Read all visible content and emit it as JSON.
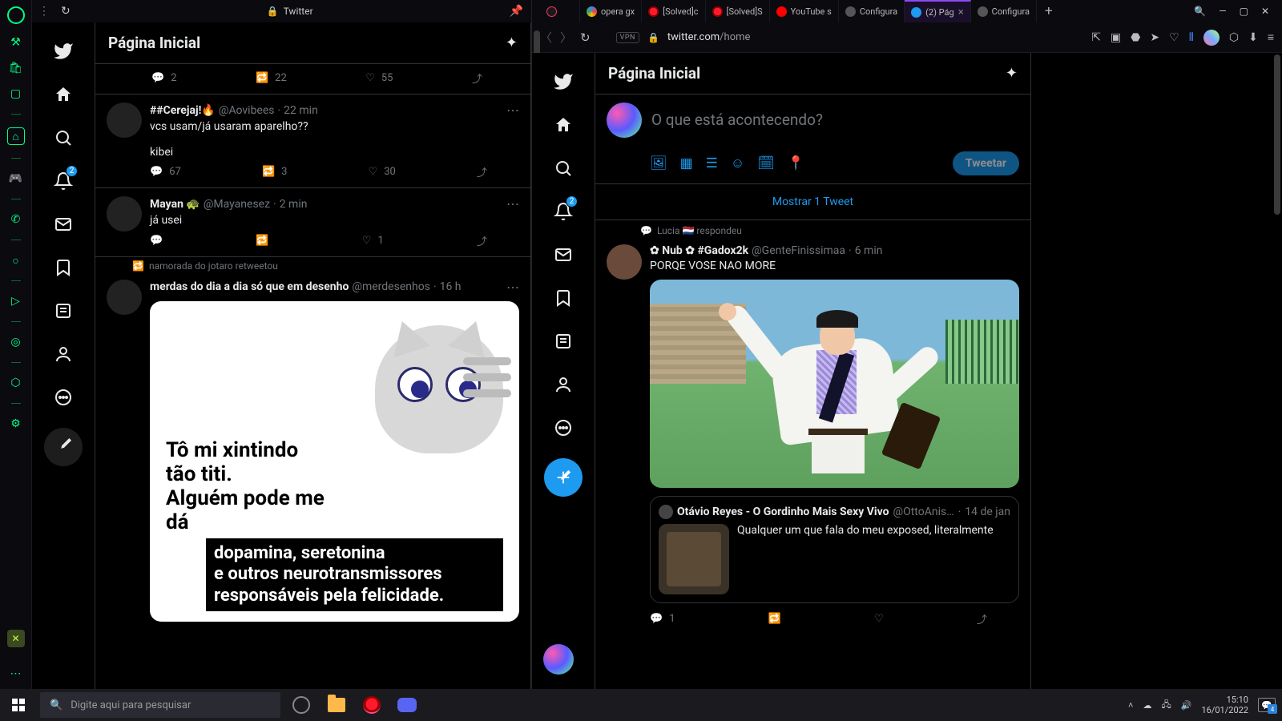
{
  "gx_rail": {
    "icons": [
      "⚙",
      "🛒",
      "📺",
      "⬚",
      "🎮",
      "—",
      "📞",
      "—",
      "○",
      "—",
      "▷",
      "—",
      "⊙",
      "—",
      "⬡",
      "—",
      "⚙"
    ]
  },
  "left_tab": {
    "title": "Twitter"
  },
  "browser_tabs": [
    {
      "fav": "gx",
      "label": ""
    },
    {
      "fav": "gg",
      "label": "opera gx"
    },
    {
      "fav": "opera",
      "label": "[Solved]c"
    },
    {
      "fav": "opera",
      "label": "[Solved]S"
    },
    {
      "fav": "yt",
      "label": "YouTube s"
    },
    {
      "fav": "cog",
      "label": "Configura"
    },
    {
      "fav": "tw",
      "label": "(2) Pág",
      "active": true,
      "close": true
    },
    {
      "fav": "cog",
      "label": "Configura"
    }
  ],
  "addr": {
    "vpn": "VPN",
    "host": "twitter.com",
    "path": "/home"
  },
  "left_feed": {
    "title": "Página Inicial",
    "notif_badge": "2",
    "top_actions": {
      "reply": "2",
      "rt": "22",
      "like": "55"
    },
    "tweets": [
      {
        "name": "##Cerejaj!🔥",
        "handle": "@Aovibees",
        "time": "22 min",
        "text": "vcs usam/já usaram aparelho??",
        "text2": "kibei",
        "reply": "67",
        "rt": "3",
        "like": "30"
      },
      {
        "name": "Mayan 🐢",
        "handle": "@Mayanesez",
        "time": "2 min",
        "text": "já usei",
        "reply": "",
        "rt": "",
        "like": "1"
      }
    ],
    "rt_context": "namorada do jotaro retweetou",
    "meme_tweet": {
      "name": "merdas do dia a dia só que em desenho",
      "handle": "@merdesenhos",
      "time": "16 h"
    },
    "meme_text1": "Tô mi xintindo\ntão titi.\nAlguém pode me\ndá",
    "meme_text2": "dopamina, seretonina\ne outros neurotransmissores\nresponsáveis pela felicidade."
  },
  "right_feed": {
    "title": "Página Inicial",
    "compose_placeholder": "O que está acontecendo?",
    "tweet_button": "Tweetar",
    "show_more": "Mostrar 1 Tweet",
    "context": "Lucia 🇳🇱 respondeu",
    "tweet": {
      "name": "✿ Nub ✿ #Gadox2k",
      "handle": "@GenteFinissimaa",
      "time": "6 min",
      "text": "PORQE VOSE NAO MORE"
    },
    "quote": {
      "name": "Otávio Reyes - O Gordinho Mais Sexy Vivo",
      "handle": "@OttoAnis…",
      "time": "14 de jan",
      "text": "Qualquer um que fala do meu exposed, literalmente"
    },
    "actions": {
      "reply": "1"
    },
    "notif_badge": "2"
  },
  "taskbar": {
    "search_placeholder": "Digite aqui para pesquisar",
    "time": "15:10",
    "date": "16/01/2022",
    "notif_count": "4"
  }
}
